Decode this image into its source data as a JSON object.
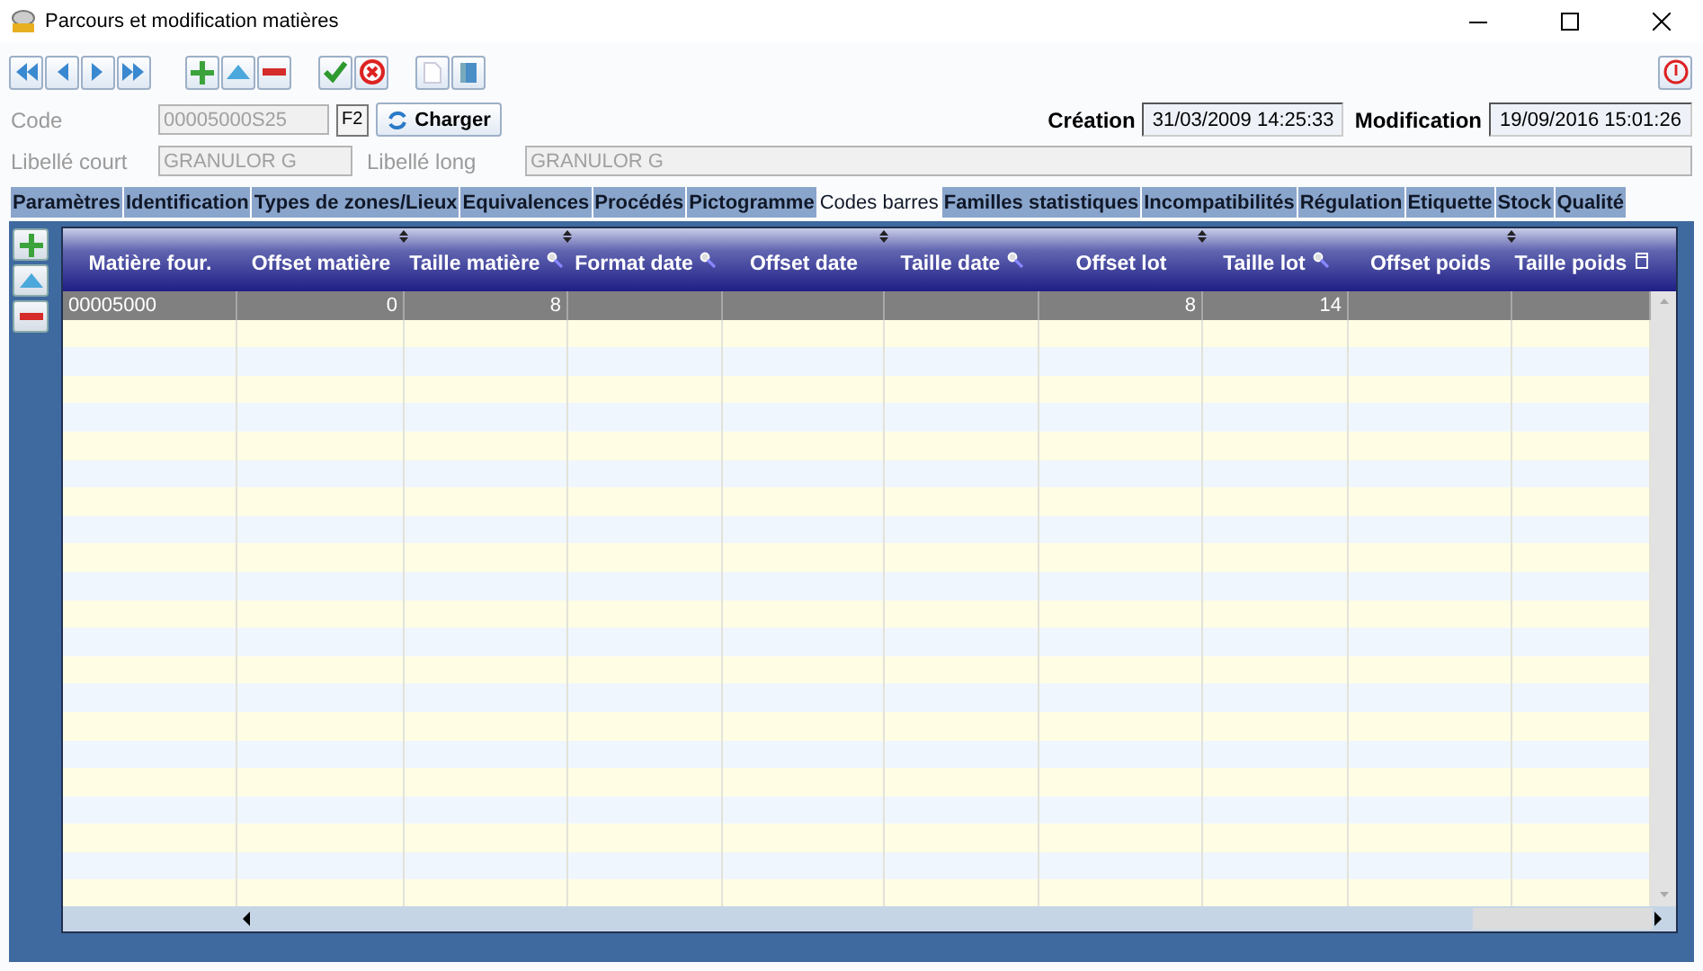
{
  "window": {
    "title": "Parcours et modification matières"
  },
  "toolbar": [
    {
      "kind": "first"
    },
    {
      "kind": "prev"
    },
    {
      "kind": "next"
    },
    {
      "kind": "last"
    },
    {
      "kind": "gap"
    },
    {
      "kind": "add"
    },
    {
      "kind": "up"
    },
    {
      "kind": "remove"
    },
    {
      "kind": "gap"
    },
    {
      "kind": "validate"
    },
    {
      "kind": "cancel"
    },
    {
      "kind": "gap"
    },
    {
      "kind": "page"
    },
    {
      "kind": "book"
    }
  ],
  "code": {
    "label": "Code",
    "value": "00005000S25",
    "disabled": true,
    "key": "F2",
    "button": "Charger"
  },
  "creation": {
    "label": "Création",
    "value": "31/03/2009 14:25:33"
  },
  "modification": {
    "label": "Modification",
    "value": "19/09/2016 15:01:26"
  },
  "libelle_court": {
    "label": "Libellé court",
    "value": "GRANULOR G",
    "disabled": true
  },
  "libelle_long": {
    "label": "Libellé long",
    "value": "GRANULOR G",
    "disabled": true
  },
  "tabs": [
    {
      "label": "Paramètres",
      "selected": false
    },
    {
      "label": "Identification",
      "selected": false
    },
    {
      "label": "Types de zones/Lieux",
      "selected": false
    },
    {
      "label": "Equivalences",
      "selected": false
    },
    {
      "label": "Procédés",
      "selected": false
    },
    {
      "label": "Pictogramme",
      "selected": false
    },
    {
      "label": "Codes barres",
      "selected": true
    },
    {
      "label": "Familles statistiques",
      "selected": false
    },
    {
      "label": "Incompatibilités",
      "selected": false
    },
    {
      "label": "Régulation",
      "selected": false
    },
    {
      "label": "Etiquette",
      "selected": false
    },
    {
      "label": "Stock",
      "selected": false
    },
    {
      "label": "Qualité",
      "selected": false
    }
  ],
  "table": {
    "columns": [
      {
        "label": "Matière four.",
        "kind": "plain"
      },
      {
        "label": "Offset matière",
        "kind": "plain"
      },
      {
        "label": "Taille matière",
        "kind": "search"
      },
      {
        "label": "Format date",
        "kind": "search"
      },
      {
        "label": "Offset date",
        "kind": "plain"
      },
      {
        "label": "Taille date",
        "kind": "search"
      },
      {
        "label": "Offset lot",
        "kind": "plain"
      },
      {
        "label": "Taille lot",
        "kind": "search"
      },
      {
        "label": "Offset poids",
        "kind": "plain"
      },
      {
        "label": "Taille poids",
        "kind": "chooser"
      }
    ],
    "rows": [
      {
        "selected": true,
        "cells": [
          "00005000",
          "0",
          "8",
          "",
          "",
          "",
          "8",
          "14",
          "",
          ""
        ]
      }
    ]
  }
}
